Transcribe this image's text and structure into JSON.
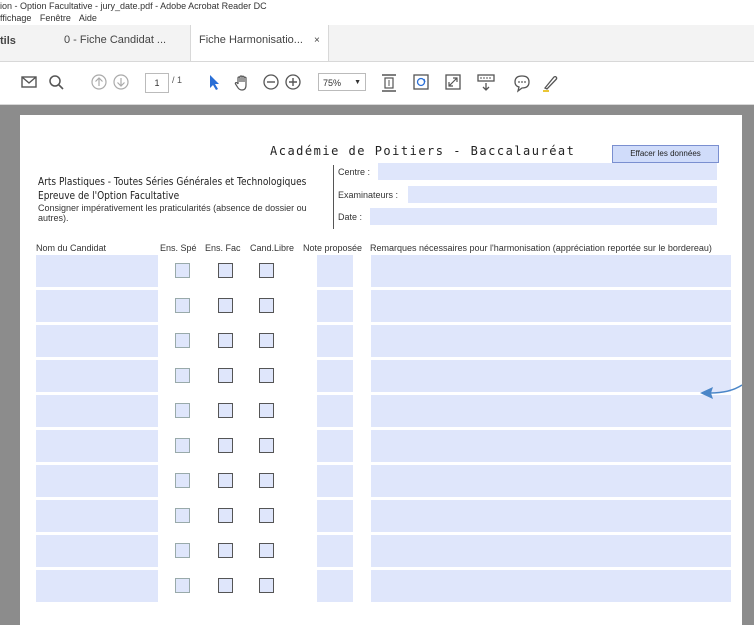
{
  "window": {
    "title": "ion - Option Facultative - jury_date.pdf - Adobe Acrobat Reader DC"
  },
  "menu": [
    "ffichage",
    "Fenêtre",
    "Aide"
  ],
  "tabs": {
    "tools_label": "tils",
    "items": [
      {
        "label": "0 - Fiche Candidat ...",
        "active": false
      },
      {
        "label": "Fiche Harmonisatio...",
        "active": true,
        "close": "×"
      }
    ]
  },
  "toolbar": {
    "page_current": "1",
    "page_total": "/ 1",
    "zoom": "75%",
    "icons": [
      "mail-icon",
      "search-icon",
      "prev-page-icon",
      "next-page-icon",
      "select-arrow-icon",
      "hand-icon",
      "zoom-out-icon",
      "zoom-in-icon",
      "fit-page-icon",
      "rotate-icon",
      "fullscreen-icon",
      "scroll-icon",
      "comment-icon",
      "highlight-pen-icon"
    ]
  },
  "document": {
    "title": "Académie de Poitiers - Baccalauréat",
    "clear_button": "Effacer les données",
    "subtitle1": "Arts Plastiques - Toutes Séries Générales et Technologiques",
    "subtitle2": "Epreuve de l'Option Facultative",
    "note": "Consigner impérativement les praticularités (absence de dossier ou autres).",
    "fields": {
      "centre": "Centre :",
      "examinateurs": "Examinateurs :",
      "date": "Date :"
    },
    "columns": {
      "nom": "Nom du Candidat",
      "ens_spe": "Ens. Spé",
      "ens_fac": "Ens. Fac",
      "cand_libre": "Cand.Libre",
      "note": "Note proposée",
      "remarques": "Remarques nécessaires pour l'harmonisation (appréciation reportée sur le bordereau)"
    },
    "row_count": 10
  },
  "colors": {
    "field_fill": "#dfe6fb",
    "viewer_bg": "#8c8c8c",
    "arrow": "#4a86c8"
  }
}
